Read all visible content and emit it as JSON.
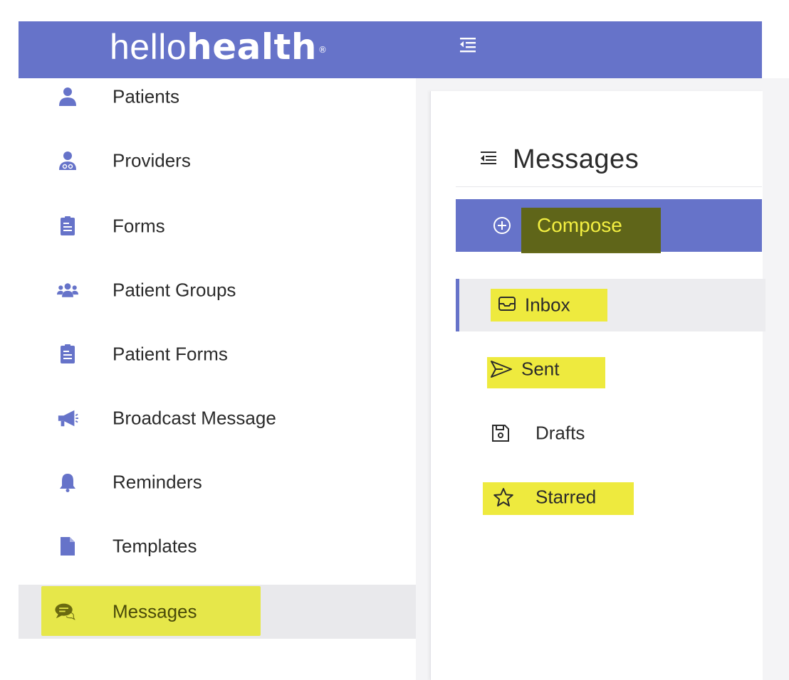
{
  "header": {
    "logo_light": "hello",
    "logo_bold": "health",
    "logo_mark": "®",
    "brand_color": "#6673c9"
  },
  "sidebar": {
    "items": [
      {
        "label": "Patients",
        "icon": "user-icon"
      },
      {
        "label": "Providers",
        "icon": "doctor-icon"
      },
      {
        "label": "Forms",
        "icon": "form-icon"
      },
      {
        "label": "Patient Groups",
        "icon": "users-group-icon"
      },
      {
        "label": "Patient Forms",
        "icon": "form-icon"
      },
      {
        "label": "Broadcast Message",
        "icon": "megaphone-icon"
      },
      {
        "label": "Reminders",
        "icon": "bell-icon"
      },
      {
        "label": "Templates",
        "icon": "file-icon"
      },
      {
        "label": "Messages",
        "icon": "chat-icon",
        "active": true
      }
    ]
  },
  "messages": {
    "title": "Messages",
    "compose_label": "Compose",
    "folders": [
      {
        "label": "Inbox",
        "icon": "inbox-icon",
        "active": true
      },
      {
        "label": "Sent",
        "icon": "send-icon"
      },
      {
        "label": "Drafts",
        "icon": "save-icon"
      },
      {
        "label": "Starred",
        "icon": "star-icon"
      }
    ]
  },
  "colors": {
    "accent": "#6673c9",
    "highlight": "#eeea3e"
  }
}
